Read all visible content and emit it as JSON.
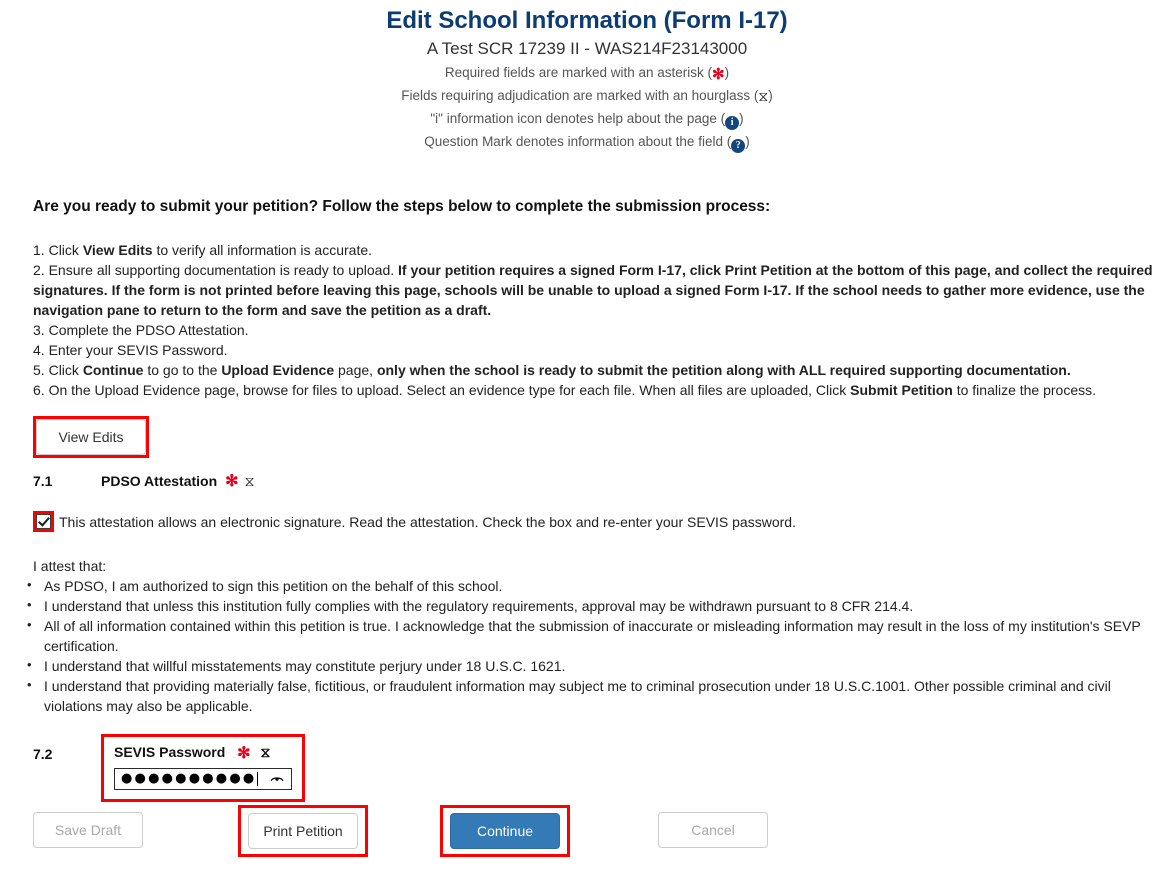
{
  "header": {
    "title": "Edit School Information (Form I-17)",
    "school_line": "A Test SCR 17239 II - WAS214F23143000",
    "legend": {
      "required_prefix": "Required fields are marked with an asterisk (",
      "required_suffix": ")",
      "adjudication_prefix": "Fields requiring adjudication are marked with an hourglass (",
      "adjudication_suffix": ")",
      "info_prefix": "\"i\" information icon denotes help about the page (",
      "info_suffix": ")",
      "question_prefix": "Question Mark denotes information about the field (",
      "question_suffix": ")",
      "asterisk_glyph": "✻",
      "hourglass_glyph": "⧖",
      "info_glyph": "i",
      "question_glyph": "?"
    }
  },
  "instructions": {
    "heading": "Are you ready to submit your petition? Follow the steps below to complete the submission process:",
    "steps": [
      {
        "number": "1.",
        "parts": [
          {
            "text": "Click ",
            "bold": false
          },
          {
            "text": "View Edits",
            "bold": true
          },
          {
            "text": " to verify all information is accurate.",
            "bold": false
          }
        ]
      },
      {
        "number": "2.",
        "parts": [
          {
            "text": "Ensure all supporting documentation is ready to upload. ",
            "bold": false
          },
          {
            "text": "If your petition requires a signed Form I-17, click Print Petition at the bottom of this page, and collect the required signatures. If the form is not printed before leaving this page, schools will be unable to upload a signed Form I-17. If the school needs to gather more evidence, use the navigation pane to return to the form and save the petition as a draft.",
            "bold": true
          }
        ]
      },
      {
        "number": "3.",
        "parts": [
          {
            "text": "Complete the PDSO Attestation.",
            "bold": false
          }
        ]
      },
      {
        "number": "4.",
        "parts": [
          {
            "text": "Enter your SEVIS Password.",
            "bold": false
          }
        ]
      },
      {
        "number": "5.",
        "parts": [
          {
            "text": "Click ",
            "bold": false
          },
          {
            "text": "Continue",
            "bold": true
          },
          {
            "text": " to go to the ",
            "bold": false
          },
          {
            "text": "Upload Evidence",
            "bold": true
          },
          {
            "text": " page, ",
            "bold": false
          },
          {
            "text": "only when the school is ready to submit the petition along with ALL required supporting documentation.",
            "bold": true
          }
        ]
      },
      {
        "number": "6.",
        "parts": [
          {
            "text": "On the Upload Evidence page, browse for files to upload. Select an evidence type for each file. When all files are uploaded, Click ",
            "bold": false
          },
          {
            "text": "Submit Petition",
            "bold": true
          },
          {
            "text": " to finalize the process.",
            "bold": false
          }
        ]
      }
    ],
    "view_edits_label": "View Edits"
  },
  "attestation": {
    "section_number": "7.1",
    "section_label": "PDSO Attestation",
    "checkbox_checked": true,
    "checkbox_text": "This attestation allows an electronic signature. Read the attestation. Check the box and re-enter your SEVIS password.",
    "intro": "I attest that:",
    "items": [
      "As PDSO, I am authorized to sign this petition on the behalf of this school.",
      "I understand that unless this institution fully complies with the regulatory requirements, approval may be withdrawn pursuant to 8 CFR 214.4.",
      "All of all information contained within this petition is true. I acknowledge that the submission of inaccurate or misleading information may result in the loss of my institution's SEVP certification.",
      "I understand that willful misstatements may constitute perjury under 18 U.S.C. 1621.",
      "I understand that providing materially false, fictitious, or fraudulent information may subject me to criminal prosecution under 18 U.S.C.1001. Other possible criminal and civil violations may also be applicable."
    ]
  },
  "password": {
    "section_number": "7.2",
    "label": "SEVIS Password",
    "masked_value": "●●●●●●●●●●",
    "character_count": 10,
    "reveal_icon": "eye-icon"
  },
  "footer": {
    "save_draft_label": "Save Draft",
    "print_petition_label": "Print Petition",
    "continue_label": "Continue",
    "cancel_label": "Cancel"
  },
  "colors": {
    "title_blue": "#0b3d73",
    "required_red": "#e8001c",
    "highlight_red": "#ff0000",
    "primary_button_blue": "#337ab7",
    "icon_blue": "#12477f"
  }
}
